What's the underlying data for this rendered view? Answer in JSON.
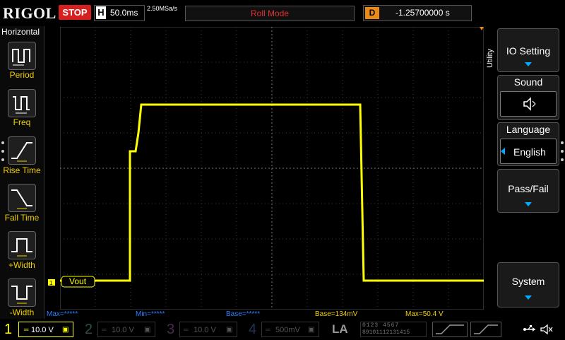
{
  "header": {
    "brand": "RIGOL",
    "run_state": "STOP",
    "timebase_letter": "H",
    "timebase": "50.0ms",
    "sample_rate": "2.50MSa/s",
    "memory_depth": "",
    "trigger_mode": "Roll Mode",
    "delay_letter": "D",
    "delay_value": "-1.25700000 s"
  },
  "horizontal_menu": {
    "title": "Horizontal",
    "items": [
      {
        "label": "Period",
        "icon": "period-icon"
      },
      {
        "label": "Freq",
        "icon": "freq-icon"
      },
      {
        "label": "Rise Time",
        "icon": "rise-time-icon"
      },
      {
        "label": "Fall Time",
        "icon": "fall-time-icon"
      },
      {
        "label": "+Width",
        "icon": "pos-width-icon"
      },
      {
        "label": "-Width",
        "icon": "neg-width-icon"
      }
    ]
  },
  "waveform": {
    "label": "Vout",
    "channel_marker": "1",
    "color": "#ffff00"
  },
  "utility_menu": {
    "side_label": "Utility",
    "io_setting": "IO Setting",
    "sound": "Sound",
    "language": "Language",
    "language_value": "English",
    "pass_fail": "Pass/Fail",
    "system": "System"
  },
  "measurements": {
    "max": "Max=*****",
    "min": "Min=*****",
    "base": "Base=*****",
    "base2": "Base=134mV",
    "max2": "Max=50.4 V"
  },
  "channels": [
    {
      "num": "1",
      "scale": "10.0 V",
      "color": "#ffff00",
      "active": true
    },
    {
      "num": "2",
      "scale": "10.0 V",
      "color": "#00c8ff",
      "active": false
    },
    {
      "num": "3",
      "scale": "10.0 V",
      "color": "#ff00ff",
      "active": false
    },
    {
      "num": "4",
      "scale": "500mV",
      "color": "#1e6eff",
      "active": false
    }
  ],
  "la": {
    "label": "LA",
    "row1": "0123 4567",
    "row2": "89101112131415"
  },
  "colors": {
    "trace": "#ffff00",
    "stop": "#d62020",
    "measure_blue": "#2a7fff",
    "measure_yellow": "#f0d000",
    "accent_orange": "#e88a1a"
  }
}
